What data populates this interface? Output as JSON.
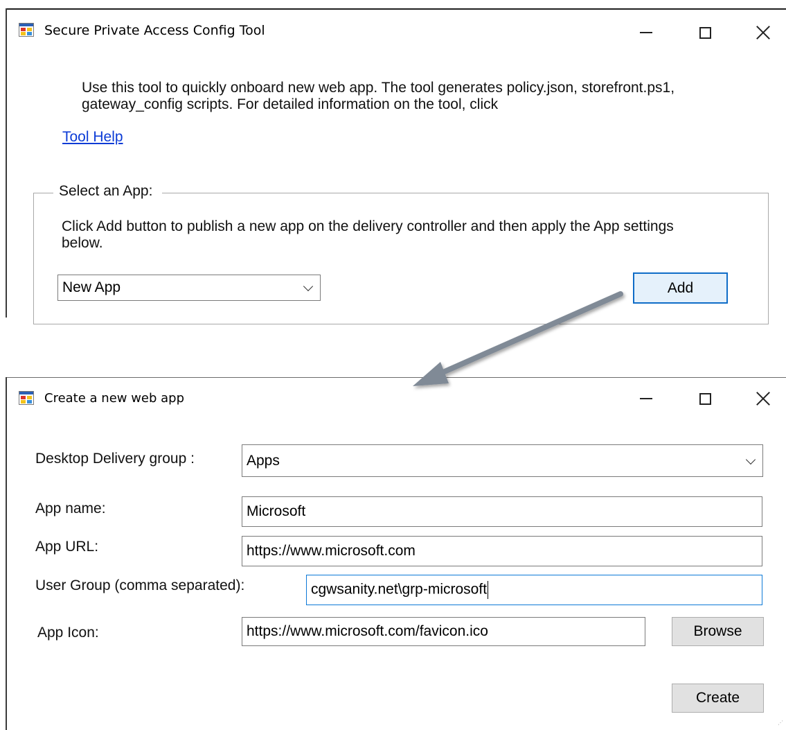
{
  "window1": {
    "title": "Secure Private Access Config Tool",
    "icon": "form-app-icon",
    "description": "Use this tool to quickly onboard new web app. The tool generates policy.json, storefront.ps1, gateway_config scripts. For detailed information on the tool, click",
    "help_link": "Tool Help",
    "group": {
      "legend": "Select an App:",
      "description": "Click Add button to publish a new app on the delivery controller and then apply the App settings below.",
      "app_select": {
        "value": "New App",
        "icon": "chevron-down-icon"
      },
      "add_button": "Add"
    },
    "caption_icons": [
      "minimize-icon",
      "maximize-icon",
      "close-icon"
    ]
  },
  "window2": {
    "title": "Create a new web app",
    "icon": "form-app-icon",
    "fields": {
      "delivery_group": {
        "label": "Desktop Delivery group :",
        "value": "Apps",
        "icon": "chevron-down-icon"
      },
      "app_name": {
        "label": "App name:",
        "value": "Microsoft"
      },
      "app_url": {
        "label": "App URL:",
        "value": "https://www.microsoft.com"
      },
      "user_group": {
        "label": "User Group (comma separated):",
        "value": "cgwsanity.net\\grp-microsoft"
      },
      "app_icon": {
        "label": "App Icon:",
        "value": "https://www.microsoft.com/favicon.ico"
      }
    },
    "browse_button": "Browse",
    "create_button": "Create",
    "caption_icons": [
      "minimize-icon",
      "maximize-icon",
      "close-icon"
    ]
  },
  "annotation": {
    "icon": "callout-arrow-icon",
    "color": "#808a96"
  },
  "colors": {
    "link": "#0b3bd6",
    "default_button_border": "#0f6cc7",
    "focused_input_border": "#0b78d7",
    "button_face": "#e1e1e1"
  }
}
